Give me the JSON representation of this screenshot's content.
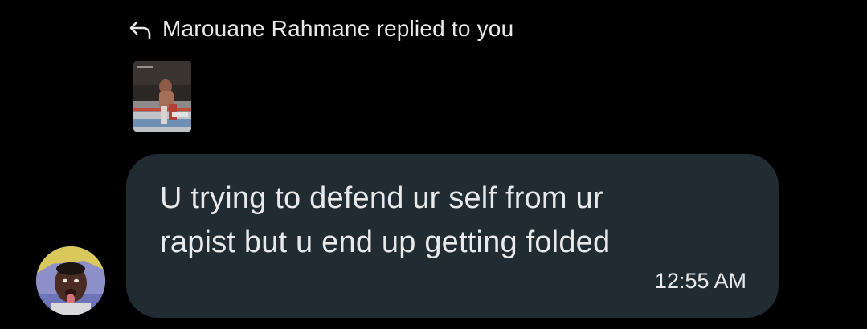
{
  "reply_header": {
    "icon": "reply-arrow-icon",
    "text": "Marouane Rahmane replied to you"
  },
  "replied_media": {
    "type": "gif-thumbnail",
    "alt": "UFC fight clip thumbnail"
  },
  "message": {
    "text": "U trying to defend ur self from ur rapist but u end up getting folded",
    "time": "12:55 AM"
  },
  "sender": {
    "avatar": "user-avatar"
  },
  "colors": {
    "background": "#000000",
    "bubble": "#202b32",
    "text": "#e7e9ea"
  }
}
